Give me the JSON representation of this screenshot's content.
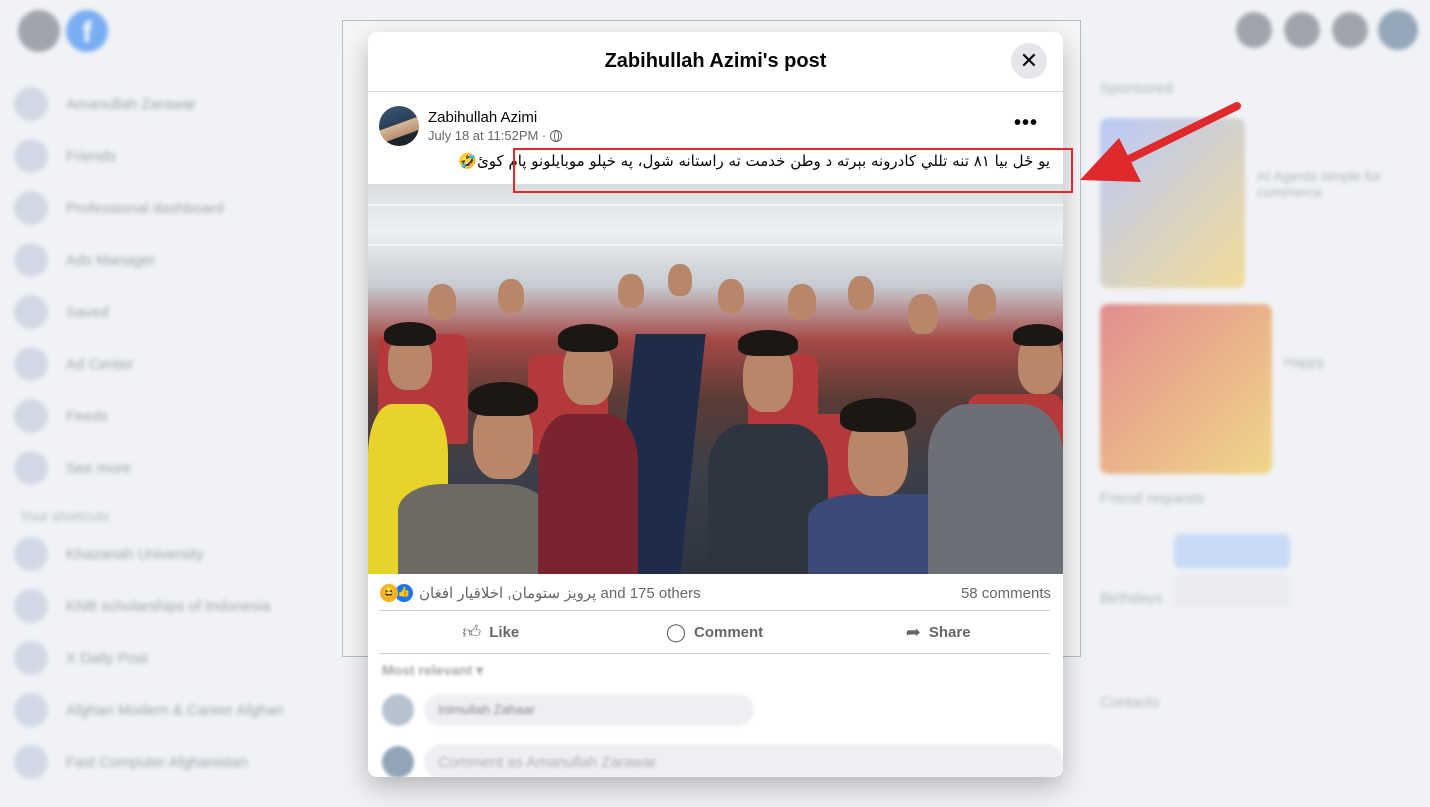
{
  "background": {
    "left_items": [
      "Amanullah Zarawar",
      "Friends",
      "Professional dashboard",
      "Ads Manager",
      "Saved",
      "Ad Center",
      "Feeds",
      "See more"
    ],
    "section_title": "Your shortcuts",
    "shortcuts": [
      "Khazanah University",
      "KNB scholarships of Indonesia",
      "X Daily Post",
      "Afghan Modern & Career Afghan",
      "Fast Computer Afghanistan"
    ],
    "right_sponsored": "Sponsored",
    "right_ads": [
      "AI Agents simple for commerce",
      "Happy"
    ],
    "friend_requests": "Friend requests",
    "birthdays": "Birthdays",
    "contacts": "Contacts"
  },
  "modal": {
    "title": "Zabihullah Azimi's post",
    "close_icon": "close-icon"
  },
  "post": {
    "author": "Zabihullah Azimi",
    "timestamp": "July 18 at 11:52PM ·",
    "more": "•••",
    "text": "یو ځل بیا ۸۱ تنه تللي کادرونه بېرته د وطن خدمت ته راستانه شول، په خپلو موبایلونو پام کوئ🤣",
    "reactors": "پرویز ستومان, اخلاقیار افغان and 175 others",
    "comments_count": "58 comments"
  },
  "actions": {
    "like": "Like",
    "comment": "Comment",
    "share": "Share"
  },
  "comments": {
    "sort_label": "Most relevant ▾",
    "first_commenter": "Inimullah Zahaar",
    "input_placeholder": "Comment as Amanullah Zarawar"
  },
  "annotation": {
    "color": "#e0292a"
  }
}
